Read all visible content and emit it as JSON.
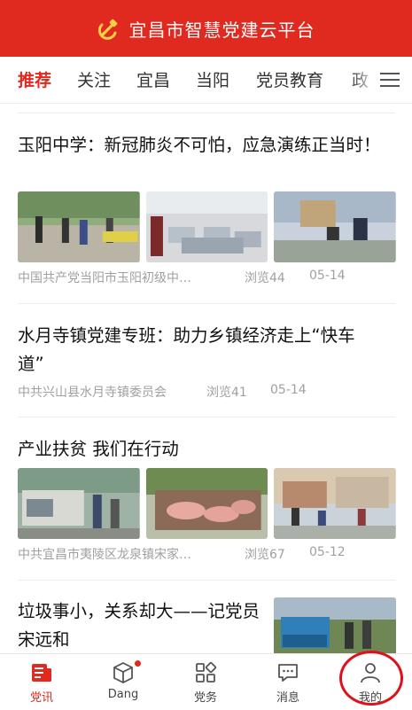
{
  "app": {
    "title": "宜昌市智慧党建云平台",
    "brand_color": "#e0291f"
  },
  "tabs": [
    "推荐",
    "关注",
    "宜昌",
    "当阳",
    "党员教育",
    "政"
  ],
  "articles": [
    {
      "title": "玉阳中学：新冠肺炎不可怕，应急演练正当时！",
      "source": "中国共产党当阳市玉阳初级中…",
      "views": "浏览44",
      "date": "05-14"
    },
    {
      "title": "水月寺镇党建专班：助力乡镇经济走上“快车道”",
      "source": "中共兴山县水月寺镇委员会",
      "views": "浏览41",
      "date": "05-14"
    },
    {
      "title": "产业扶贫 我们在行动",
      "source": "中共宜昌市夷陵区龙泉镇宋家…",
      "views": "浏览67",
      "date": "05-12"
    },
    {
      "title": "垃圾事小，关系却大——记党员宋远和"
    }
  ],
  "bottom_nav": [
    {
      "label": "党讯",
      "icon": "news-icon"
    },
    {
      "label": "Dang",
      "icon": "cube-icon"
    },
    {
      "label": "党务",
      "icon": "grid-icon"
    },
    {
      "label": "消息",
      "icon": "message-icon"
    },
    {
      "label": "我的",
      "icon": "person-icon"
    }
  ]
}
